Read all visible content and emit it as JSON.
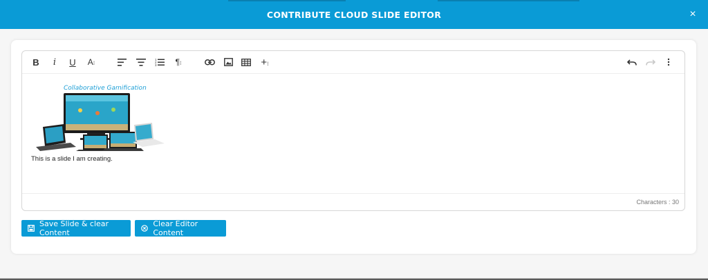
{
  "modal": {
    "title": "CONTRIBUTE CLOUD SLIDE EDITOR",
    "close_label": "×",
    "header_color": "#0a9bd6"
  },
  "toolbar": {
    "items": [
      {
        "name": "bold-button",
        "icon": "bold-icon",
        "glyph": "B"
      },
      {
        "name": "italic-button",
        "icon": "italic-icon",
        "glyph": "i"
      },
      {
        "name": "underline-button",
        "icon": "underline-icon",
        "glyph": "U"
      },
      {
        "name": "font-size-button",
        "icon": "font-size-icon",
        "glyph": "A"
      },
      {
        "name": "align-left-button",
        "icon": "align-left-icon"
      },
      {
        "name": "align-center-button",
        "icon": "align-center-icon"
      },
      {
        "name": "ordered-list-button",
        "icon": "ordered-list-icon"
      },
      {
        "name": "paragraph-format-button",
        "icon": "paragraph-icon",
        "glyph": "¶"
      },
      {
        "name": "insert-link-button",
        "icon": "link-icon"
      },
      {
        "name": "insert-image-button",
        "icon": "image-icon"
      },
      {
        "name": "insert-table-button",
        "icon": "table-icon"
      },
      {
        "name": "insert-more-button",
        "icon": "plus-icon"
      },
      {
        "name": "undo-button",
        "icon": "undo-icon"
      },
      {
        "name": "redo-button",
        "icon": "redo-icon"
      },
      {
        "name": "more-options-button",
        "icon": "kebab-icon"
      }
    ]
  },
  "editor": {
    "image_caption": "Collaborative Gamification",
    "body_text": "This is a slide I am creating.",
    "character_count": "Characters : 30"
  },
  "actions": {
    "save_label": "Save Slide & clear Content",
    "clear_label": "Clear Editor Content"
  },
  "colors": {
    "accent": "#0a9bd6",
    "caption": "#1e9fd6"
  }
}
